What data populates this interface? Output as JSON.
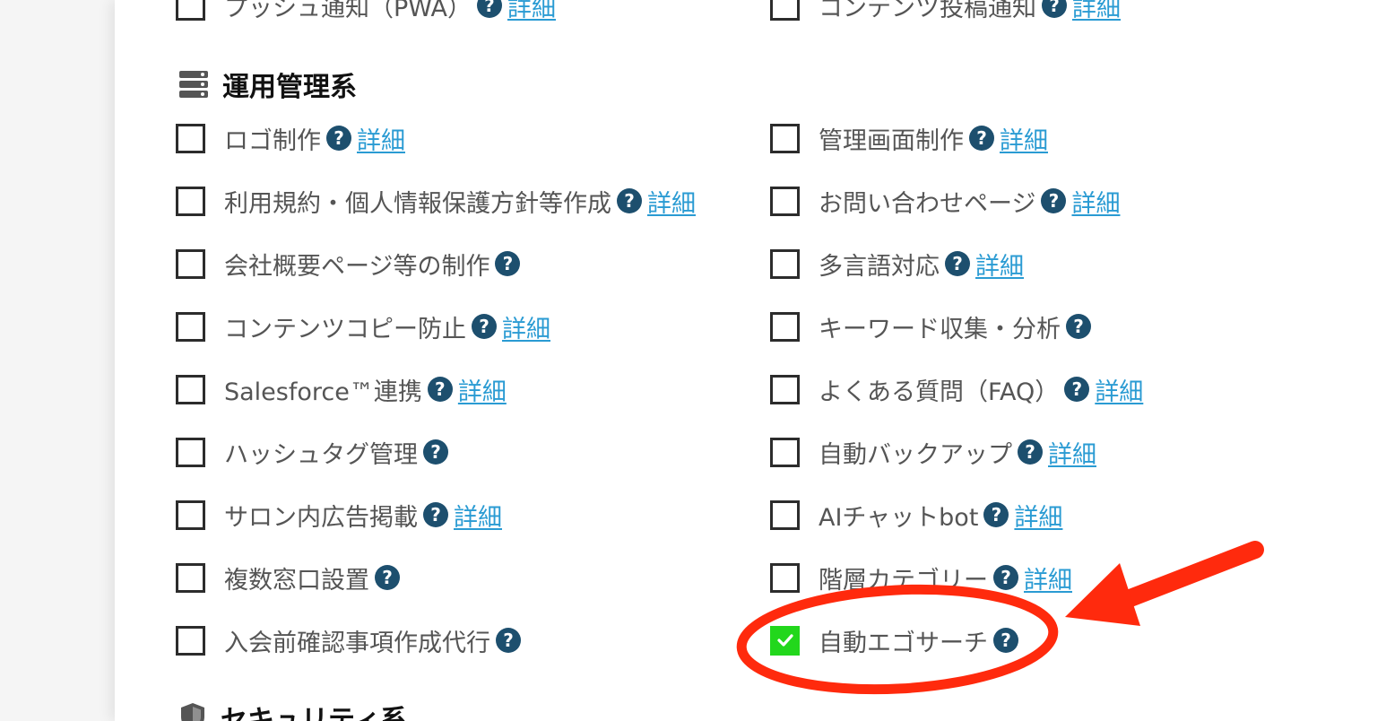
{
  "top_items": [
    {
      "label": "プッシュ通知（PWA）",
      "detail": "詳細"
    },
    {
      "label": "コンテンツ投稿通知",
      "detail": "詳細"
    }
  ],
  "sections": [
    {
      "title": "運用管理系",
      "icon": "server-icon"
    },
    {
      "title": "セキュリティ系",
      "icon": "shield-icon"
    }
  ],
  "left_items": [
    {
      "label": "ロゴ制作",
      "detail": "詳細",
      "checked": false
    },
    {
      "label": "利用規約・個人情報保護方針等作成",
      "detail": "詳細",
      "checked": false
    },
    {
      "label": "会社概要ページ等の制作",
      "detail": "",
      "checked": false
    },
    {
      "label": "コンテンツコピー防止",
      "detail": "詳細",
      "checked": false
    },
    {
      "label": "Salesforce™連携",
      "detail": "詳細",
      "checked": false
    },
    {
      "label": "ハッシュタグ管理",
      "detail": "",
      "checked": false
    },
    {
      "label": "サロン内広告掲載",
      "detail": "詳細",
      "checked": false
    },
    {
      "label": "複数窓口設置",
      "detail": "",
      "checked": false
    },
    {
      "label": "入会前確認事項作成代行",
      "detail": "",
      "checked": false
    }
  ],
  "right_items": [
    {
      "label": "管理画面制作",
      "detail": "詳細",
      "checked": false
    },
    {
      "label": "お問い合わせページ",
      "detail": "詳細",
      "checked": false
    },
    {
      "label": "多言語対応",
      "detail": "詳細",
      "checked": false
    },
    {
      "label": "キーワード収集・分析",
      "detail": "",
      "checked": false
    },
    {
      "label": "よくある質問（FAQ）",
      "detail": "詳細",
      "checked": false
    },
    {
      "label": "自動バックアップ",
      "detail": "詳細",
      "checked": false
    },
    {
      "label": "AIチャットbot",
      "detail": "詳細",
      "checked": false
    },
    {
      "label": "階層カテゴリー",
      "detail": "詳細",
      "checked": false
    },
    {
      "label": "自動エゴサーチ",
      "detail": "",
      "checked": true
    }
  ],
  "help_glyph": "?",
  "colors": {
    "help_icon": "#1d4f6e",
    "detail_link": "#2a9bd3",
    "checked": "#22d71c",
    "annotation": "#ff2a0d"
  }
}
